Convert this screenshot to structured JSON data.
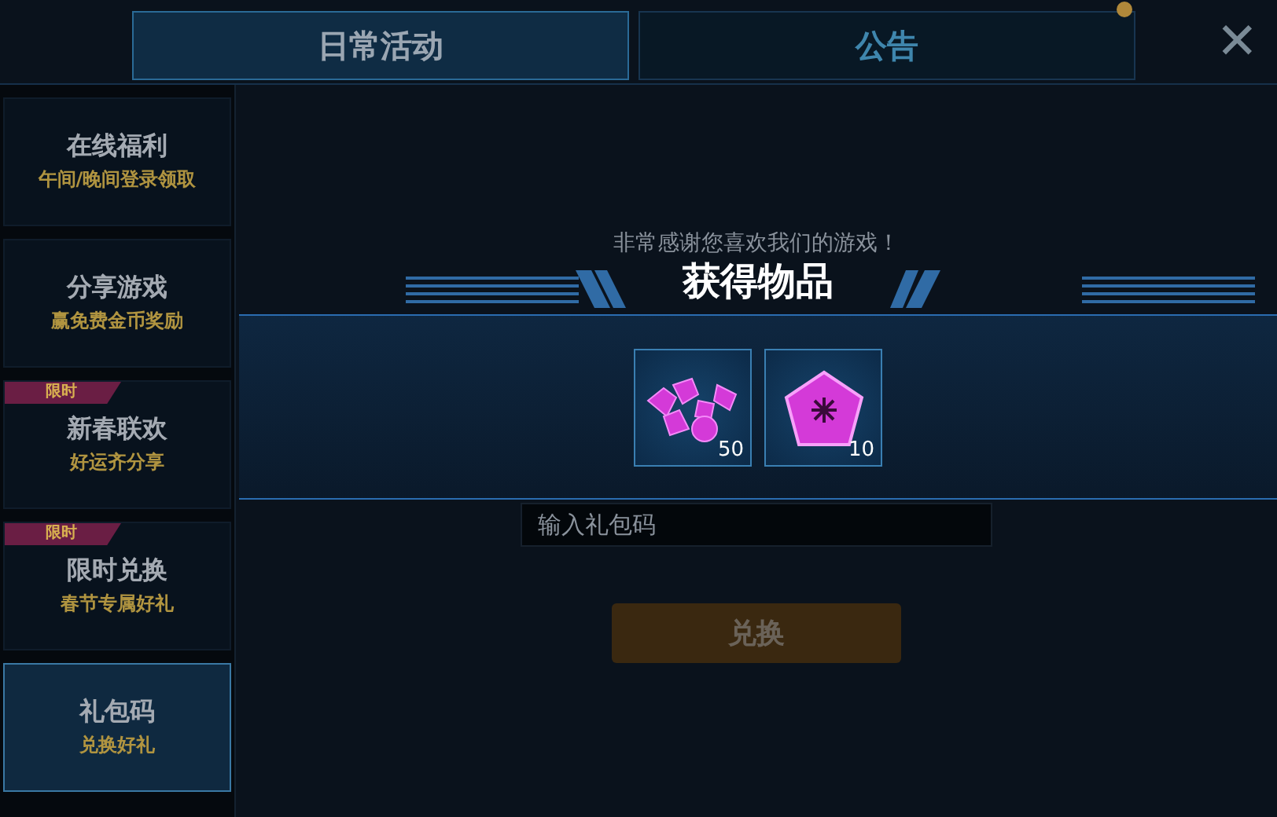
{
  "tabs": [
    {
      "label": "日常活动",
      "selected": true,
      "dot": false
    },
    {
      "label": "公告",
      "selected": false,
      "dot": true
    }
  ],
  "close": {
    "label": "✕"
  },
  "sidebar": {
    "items": [
      {
        "title": "在线福利",
        "subtitle": "午间/晚间登录领取",
        "selected": false
      },
      {
        "title": "分享游戏",
        "subtitle": "赢免费金币奖励",
        "selected": false
      },
      {
        "title": "新春联欢",
        "subtitle": "好运齐分享",
        "tag": "限时",
        "selected": false
      },
      {
        "title": "限时兑换",
        "subtitle": "春节专属好礼",
        "tag": "限时",
        "selected": false
      },
      {
        "title": "礼包码",
        "subtitle": "兑换好礼",
        "selected": true
      }
    ]
  },
  "content": {
    "lines": [
      "非常感谢您喜欢我们的游戏！"
    ],
    "field": {
      "placeholder": "输入礼包码"
    },
    "button": "兑换"
  },
  "reward_popup": {
    "title": "获得物品",
    "items": [
      {
        "kind": "gems",
        "count": "50"
      },
      {
        "kind": "crystal",
        "count": "10"
      }
    ]
  }
}
